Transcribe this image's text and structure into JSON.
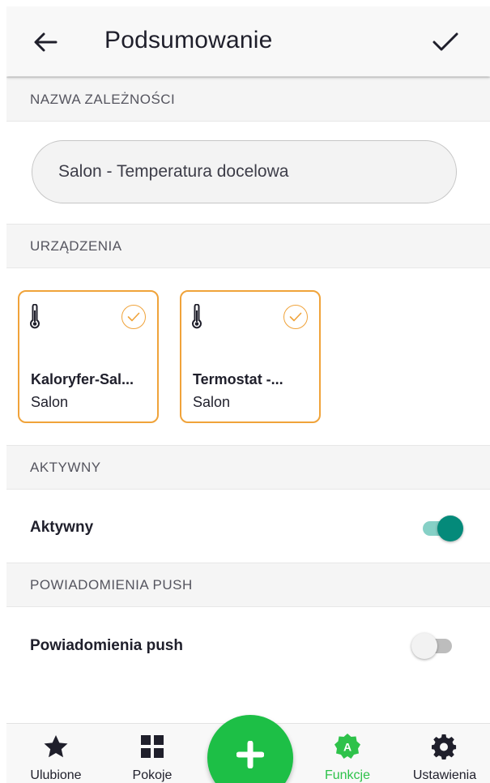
{
  "header": {
    "title": "Podsumowanie",
    "back_icon": "arrow-left-icon",
    "confirm_icon": "check-icon"
  },
  "sections": {
    "name": "NAZWA ZALEŻNOŚCI",
    "devices": "URZĄDZENIA",
    "active": "AKTYWNY",
    "push": "POWIADOMIENIA PUSH"
  },
  "name_field": {
    "value": "Salon - Temperatura docelowa"
  },
  "devices": [
    {
      "name": "Kaloryfer-Sal...",
      "room": "Salon",
      "icon": "thermometer-icon",
      "selected": true
    },
    {
      "name": "Termostat -...",
      "room": "Salon",
      "icon": "thermometer-icon",
      "selected": true
    }
  ],
  "settings": {
    "active_label": "Aktywny",
    "active_on": true,
    "push_label": "Powiadomienia push",
    "push_on": false
  },
  "bottom_nav": {
    "items": [
      {
        "label": "Ulubione",
        "icon": "star-icon"
      },
      {
        "label": "Pokoje",
        "icon": "grid-icon"
      },
      {
        "label": "Funkcje",
        "icon": "automation-icon",
        "active": true
      },
      {
        "label": "Ustawienia",
        "icon": "gear-icon"
      }
    ],
    "fab_icon": "plus-icon"
  },
  "colors": {
    "accent_orange": "#f0a33a",
    "toggle_on": "#048a7a",
    "active_green": "#2ec24a",
    "fab_green": "#1dbf46"
  }
}
